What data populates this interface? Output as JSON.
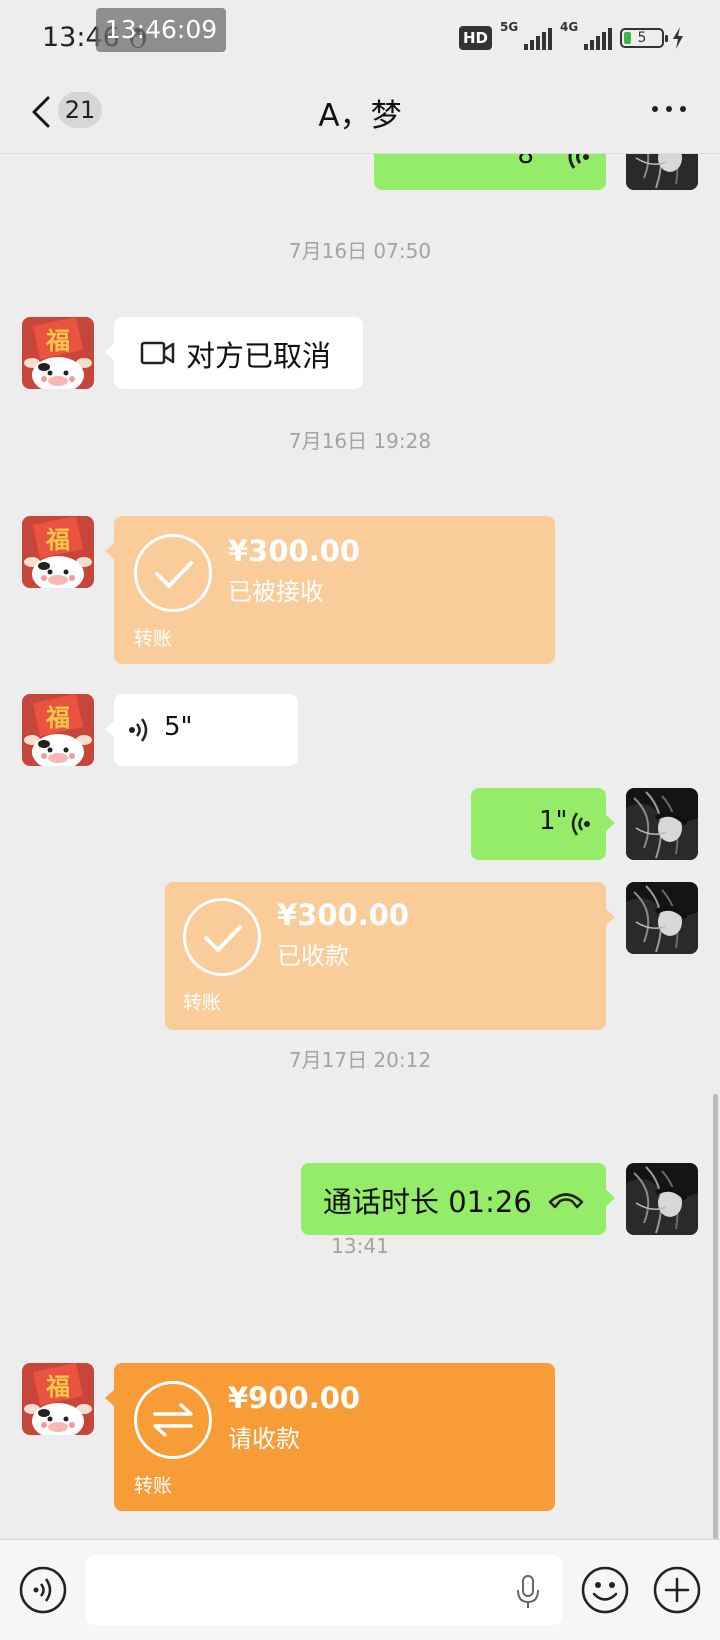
{
  "status_bar": {
    "time": "13:46",
    "overlay_time": "13:46:09",
    "hd_label": "HD",
    "network_1": "5G",
    "network_2": "4G",
    "battery": "5",
    "icons": [
      "qq-penguin-icon",
      "signal-icon",
      "battery-icon",
      "charging-icon"
    ]
  },
  "header": {
    "back_icon": "chevron-left-icon",
    "unread_count": "21",
    "title": "A，梦",
    "more_icon": "more-dots-icon"
  },
  "messages": {
    "top_partial_voice": {
      "sender": "self",
      "duration": "8\""
    },
    "ts1": "7月16日 07:50",
    "video_call": {
      "sender": "other",
      "icon": "video-camera-icon",
      "text": "对方已取消"
    },
    "ts2": "7月16日 19:28",
    "transfer1": {
      "sender": "other",
      "amount": "¥300.00",
      "status": "已被接收",
      "type": "转账",
      "icon": "check-icon"
    },
    "voice1": {
      "sender": "other",
      "duration": "5\"",
      "icon": "voice-wave-icon"
    },
    "voice2": {
      "sender": "self",
      "duration": "1\"",
      "icon": "voice-wave-icon"
    },
    "transfer2": {
      "sender": "self",
      "amount": "¥300.00",
      "status": "已收款",
      "type": "转账",
      "icon": "check-icon"
    },
    "ts3": "7月17日 20:12",
    "call_duration": {
      "sender": "self",
      "text": "通话时长 01:26",
      "icon": "phone-hangup-icon"
    },
    "ts4": "13:41",
    "transfer3": {
      "sender": "other",
      "amount": "¥900.00",
      "status": "请收款",
      "type": "转账",
      "icon": "transfer-arrows-icon"
    }
  },
  "input_bar": {
    "voice_icon": "voice-mode-icon",
    "placeholder": "",
    "mic_icon": "microphone-icon",
    "emoji_icon": "emoji-icon",
    "plus_icon": "plus-icon"
  },
  "colors": {
    "self_bubble": "#95ec69",
    "other_bubble": "#ffffff",
    "transfer_done": "#f9cc9a",
    "transfer_pending": "#f79c37",
    "background": "#ededed"
  }
}
